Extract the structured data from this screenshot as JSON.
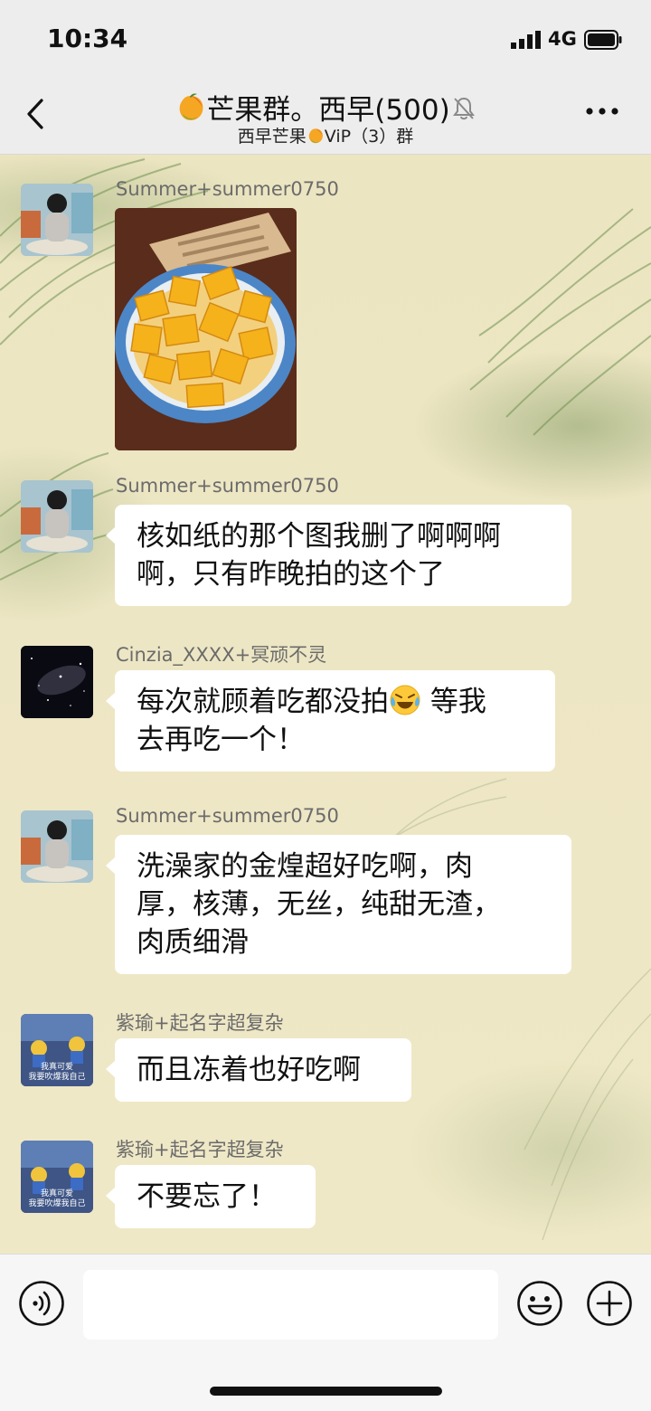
{
  "status_bar": {
    "time": "10:34",
    "network": "4G"
  },
  "header": {
    "title": "芒果群。西早(500)",
    "subtitle_prefix": "西早芒果",
    "subtitle_suffix": "ViP（3）群",
    "title_icon": "mango-icon",
    "mute_icon": "bell-muted-icon",
    "back_icon": "chevron-left-icon",
    "more_icon": "more-dots-icon"
  },
  "messages": [
    {
      "sender": "Summer+summer0750",
      "type": "image",
      "avatar": "baby",
      "image_desc": "mango-cubes-photo"
    },
    {
      "sender": "Summer+summer0750",
      "type": "text",
      "avatar": "baby",
      "lines": [
        "核如纸的那个图我删了啊啊啊",
        "啊，只有昨晚拍的这个了"
      ]
    },
    {
      "sender": "Cinzia_XXXX+冥顽不灵",
      "type": "text",
      "avatar": "space",
      "line1_before": "每次就顾着吃都没拍",
      "line1_after": " 等我",
      "line2": "去再吃一个！"
    },
    {
      "sender": "Summer+summer0750",
      "type": "text",
      "avatar": "baby",
      "lines": [
        "洗澡家的金煌超好吃啊，肉",
        "厚，核薄，无丝，纯甜无渣，",
        "肉质细滑"
      ]
    },
    {
      "sender": "紫瑜+起名字超复杂",
      "type": "text",
      "avatar": "cartoon",
      "avatar_caption": [
        "我真可爱",
        "我要吹爆我自己"
      ],
      "lines": [
        "而且冻着也好吃啊"
      ]
    },
    {
      "sender": "紫瑜+起名字超复杂",
      "type": "text",
      "avatar": "cartoon",
      "avatar_caption": [
        "我真可爱",
        "我要吹爆我自己"
      ],
      "lines": [
        "不要忘了！"
      ]
    }
  ],
  "input_bar": {
    "voice_icon": "voice-icon",
    "emoji_icon": "smiley-icon",
    "plus_icon": "plus-icon",
    "value": ""
  },
  "colors": {
    "header_bg": "#ededed",
    "bubble_bg": "#ffffff",
    "name_text": "#6b6b6b"
  }
}
